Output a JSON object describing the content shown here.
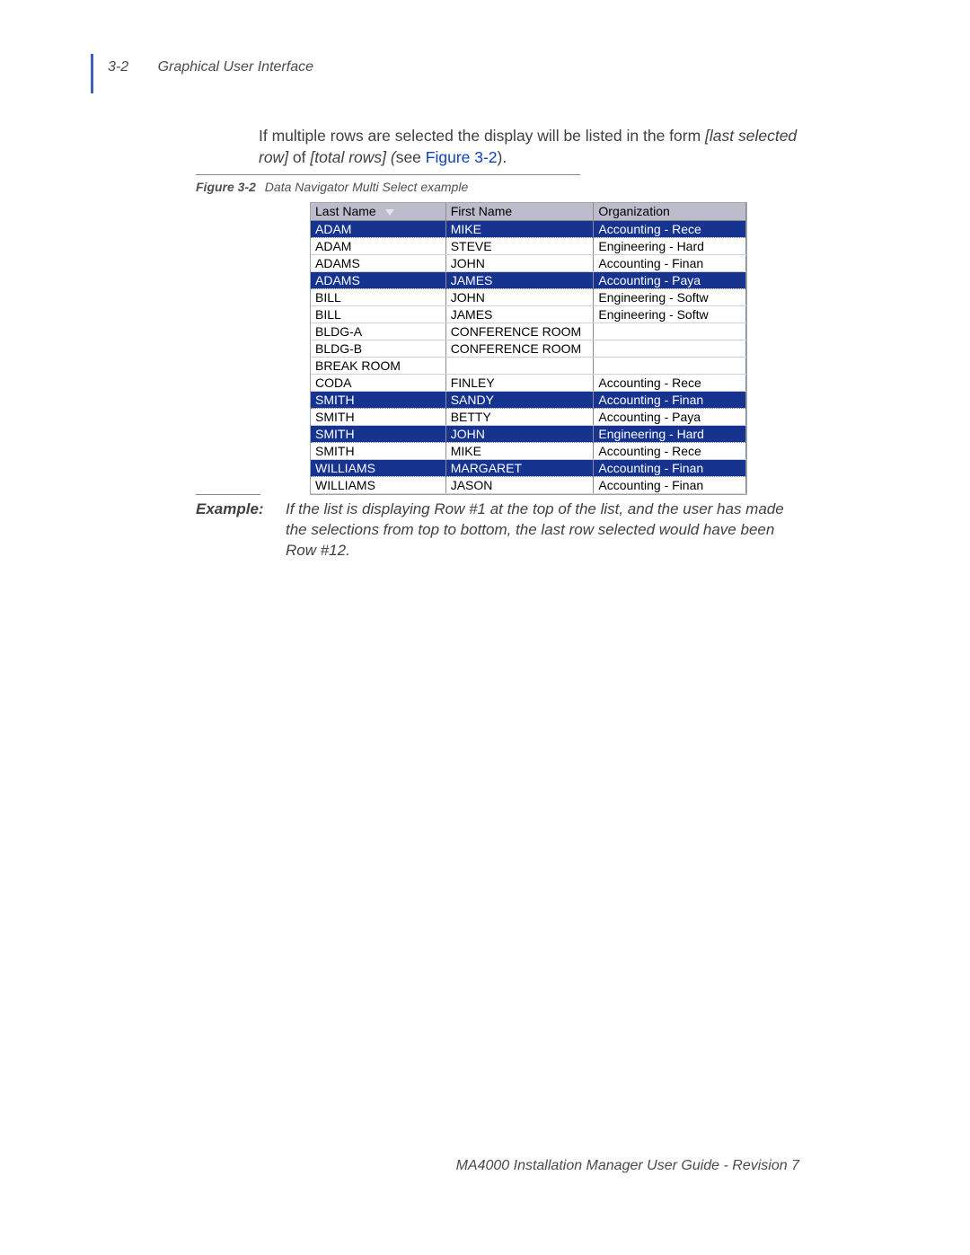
{
  "header": {
    "page_label": "3-2",
    "section_title": "Graphical User Interface"
  },
  "body": {
    "para1a": "If multiple rows are selected the display will be listed in the form ",
    "para1b": "[last selected row]",
    "para1c": " of ",
    "para1d": "[total rows] (",
    "para1e": "see ",
    "para1f": "Figure 3-2",
    "para1g": ")."
  },
  "figure": {
    "number": "Figure 3-2",
    "caption": "Data Navigator Multi Select example",
    "headers": {
      "c1": "Last Name",
      "c2": "First Name",
      "c3": "Organization"
    },
    "rows": [
      {
        "sel": true,
        "c1": "ADAM",
        "c2": "MIKE",
        "c3": "Accounting - Rece"
      },
      {
        "sel": false,
        "c1": "ADAM",
        "c2": "STEVE",
        "c3": "Engineering - Hard"
      },
      {
        "sel": false,
        "c1": "ADAMS",
        "c2": "JOHN",
        "c3": "Accounting - Finan"
      },
      {
        "sel": true,
        "c1": "ADAMS",
        "c2": "JAMES",
        "c3": "Accounting - Paya"
      },
      {
        "sel": false,
        "c1": "BILL",
        "c2": "JOHN",
        "c3": "Engineering - Softw"
      },
      {
        "sel": false,
        "c1": "BILL",
        "c2": "JAMES",
        "c3": "Engineering - Softw"
      },
      {
        "sel": false,
        "c1": "BLDG-A",
        "c2": "CONFERENCE ROOM",
        "c3": ""
      },
      {
        "sel": false,
        "c1": "BLDG-B",
        "c2": "CONFERENCE ROOM",
        "c3": ""
      },
      {
        "sel": false,
        "c1": "BREAK ROOM",
        "c2": "",
        "c3": ""
      },
      {
        "sel": false,
        "c1": "CODA",
        "c2": "FINLEY",
        "c3": "Accounting - Rece"
      },
      {
        "sel": true,
        "c1": "SMITH",
        "c2": "SANDY",
        "c3": "Accounting - Finan"
      },
      {
        "sel": false,
        "c1": "SMITH",
        "c2": "BETTY",
        "c3": "Accounting - Paya"
      },
      {
        "sel": true,
        "c1": "SMITH",
        "c2": "JOHN",
        "c3": "Engineering - Hard"
      },
      {
        "sel": false,
        "c1": "SMITH",
        "c2": "MIKE",
        "c3": "Accounting - Rece"
      },
      {
        "sel": true,
        "c1": "WILLIAMS",
        "c2": "MARGARET",
        "c3": "Accounting - Finan"
      },
      {
        "sel": false,
        "cut": true,
        "c1": "WILLIAMS",
        "c2": "JASON",
        "c3": "Accounting - Finan"
      }
    ]
  },
  "example": {
    "label": "Example:",
    "text": "If the list is displaying Row #1 at the top of the list, and the user has made the selections from top to bottom, the last row selected would have been Row #12."
  },
  "footer": {
    "text": "MA4000 Installation Manager User Guide - Revision 7"
  }
}
